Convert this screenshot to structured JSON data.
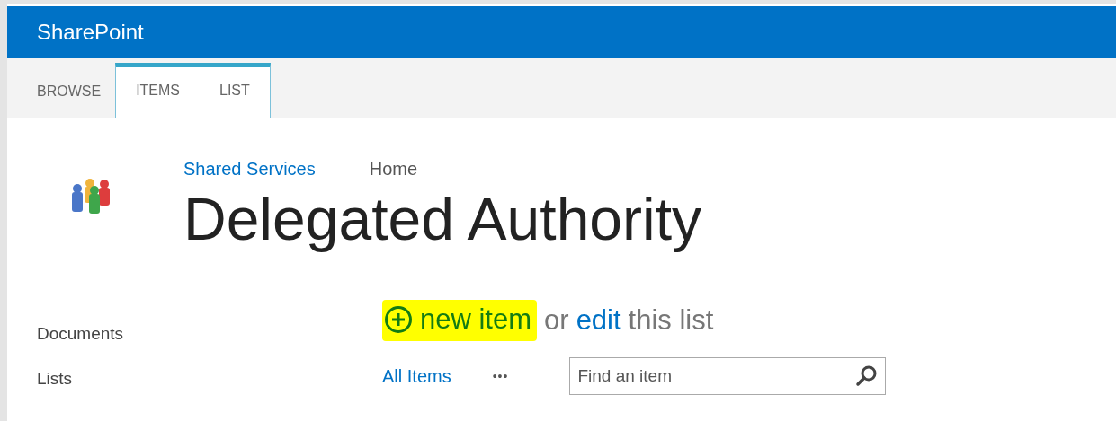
{
  "suite_bar": {
    "brand": "SharePoint"
  },
  "ribbon_tabs": [
    {
      "label": "BROWSE",
      "contextual": false
    },
    {
      "label": "ITEMS",
      "contextual": true
    },
    {
      "label": "LIST",
      "contextual": true
    }
  ],
  "breadcrumb": [
    {
      "label": "Shared Services",
      "kind": "link"
    },
    {
      "label": "Home",
      "kind": "current"
    }
  ],
  "page_title": "Delegated Authority",
  "quick_launch": [
    {
      "label": "Documents"
    },
    {
      "label": "Lists"
    }
  ],
  "new_item_bar": {
    "new_item": "new item",
    "highlighted": true,
    "or": "or",
    "edit": "edit",
    "rest": "this list"
  },
  "views": [
    {
      "label": "All Items",
      "kind": "link"
    },
    {
      "label": "•••",
      "kind": "more"
    }
  ],
  "search": {
    "placeholder": "Find an item"
  }
}
